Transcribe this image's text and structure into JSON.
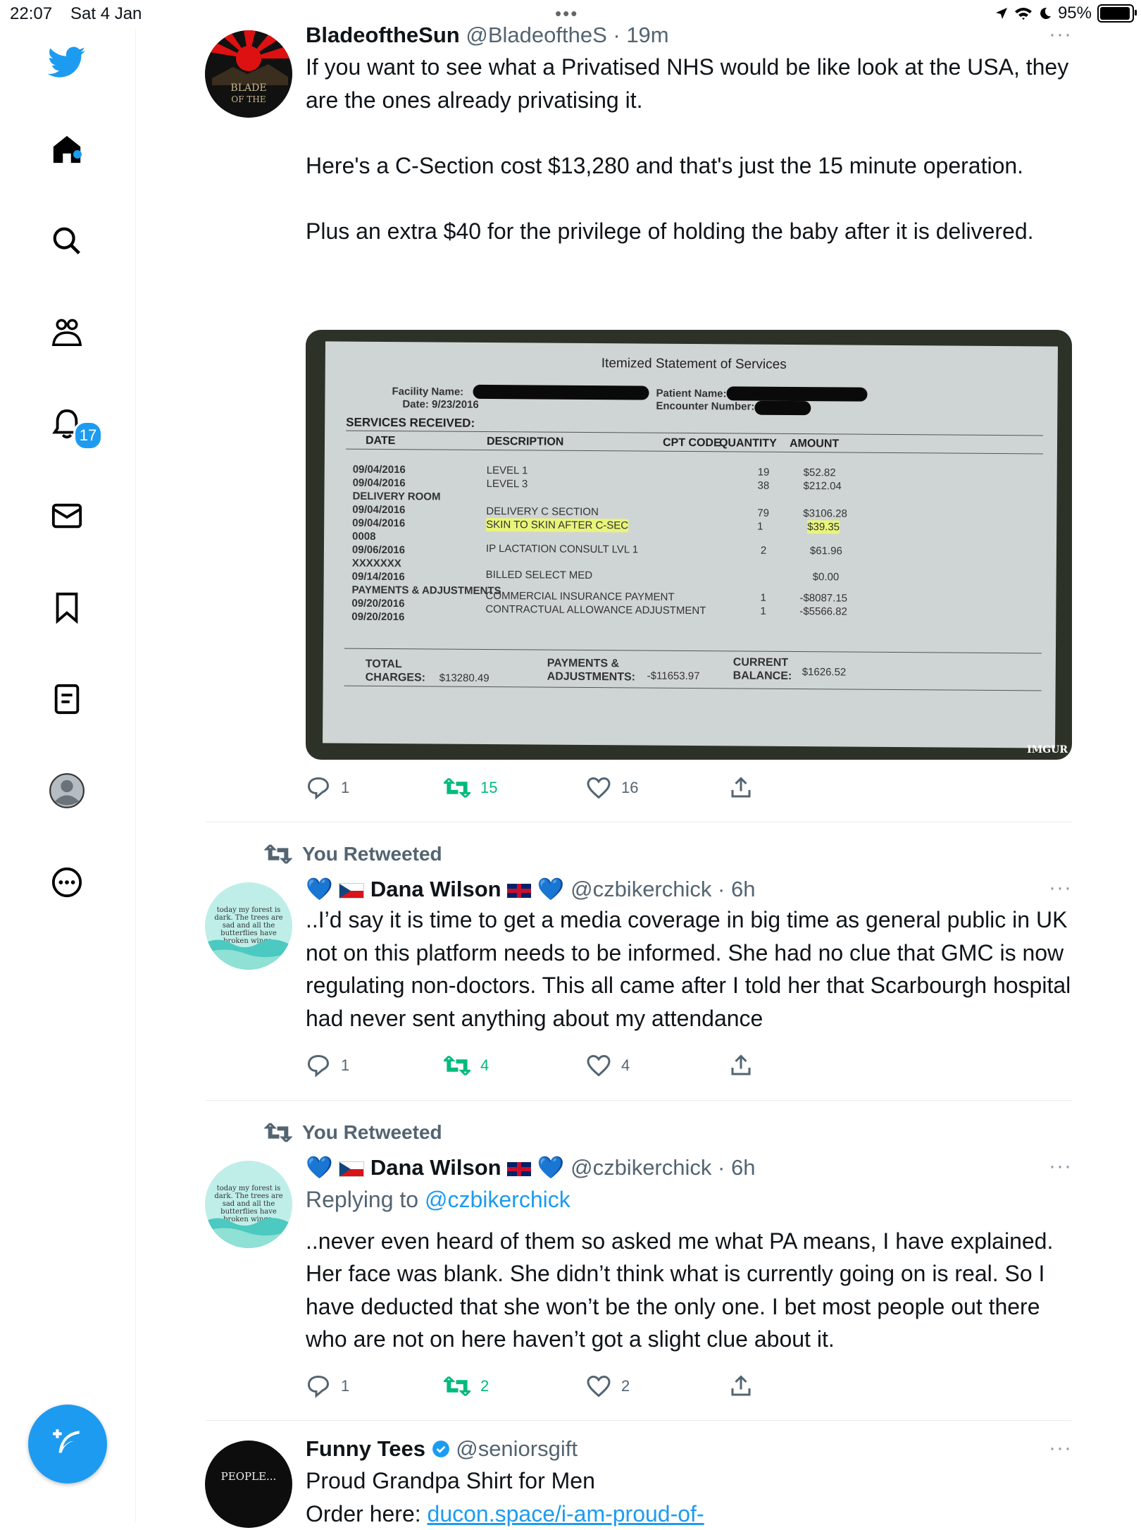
{
  "status": {
    "time": "22:07",
    "date": "Sat 4 Jan",
    "battery": "95%"
  },
  "nav": {
    "notifications_badge": "17"
  },
  "tweets": [
    {
      "name": "BladeoftheSun",
      "handle": "@BladeoftheS",
      "time": "19m",
      "avatar_text": "BLADE OF THE",
      "text": "If you want to see what a Privatised NHS would be like look at the USA, they are the ones already privatising it.\n\nHere's a C-Section cost $13,280 and that's just the 15 minute operation.\n\nPlus an extra $40 for the privilege of holding the baby after it is delivered.",
      "replies": "1",
      "retweets": "15",
      "likes": "16",
      "image": {
        "title": "Itemized Statement of Services",
        "facility_label": "Facility Name:",
        "date_label": "Date: 9/23/2016",
        "patient_label": "Patient Name:",
        "encounter_label": "Encounter Number:",
        "services_label": "SERVICES RECEIVED:",
        "col_date": "DATE",
        "col_desc": "DESCRIPTION",
        "col_cpt": "CPT CODE",
        "col_qty": "QUANTITY",
        "col_amount": "AMOUNT",
        "dates": "09/04/2016\n09/04/2016\nDELIVERY ROOM\n09/04/2016\n09/04/2016\n0008\n09/06/2016\nXXXXXXX\n09/14/2016\nPAYMENTS & ADJUSTMENTS\n09/20/2016\n09/20/2016",
        "desc_1": "LEVEL 1\nLEVEL 3",
        "desc_2": "DELIVERY C SECTION",
        "desc_3": "SKIN TO SKIN AFTER C-SEC",
        "desc_4": "IP LACTATION CONSULT LVL 1",
        "desc_5": "BILLED SELECT MED",
        "desc_6": "COMMERCIAL INSURANCE PAYMENT\nCONTRACTUAL ALLOWANCE ADJUSTMENT",
        "qty_1": "19\n38",
        "qty_2": "79\n1",
        "qty_3": "2",
        "qty_4": "1\n1",
        "amt_1": "$52.82\n$212.04",
        "amt_2": "$3106.28",
        "amt_3": "$39.35",
        "amt_4": "$61.96",
        "amt_5": "$0.00",
        "amt_6": "-$8087.15\n-$5566.82",
        "total_label": "TOTAL\nCHARGES:",
        "total_value": "$13280.49",
        "payments_label": "PAYMENTS &\nADJUSTMENTS:",
        "payments_value": "-$11653.97",
        "balance_label": "CURRENT\nBALANCE:",
        "balance_value": "$1626.52",
        "watermark": "IMGUR"
      }
    },
    {
      "retweeted_label": "You Retweeted",
      "name": "Dana Wilson",
      "handle": "@czbikerchick",
      "time": "6h",
      "avatar_text": "today my forest is dark. The trees are sad and all the butterflies have broken wings.",
      "text": "..I’d say it is time to get a media coverage in big time as general public in UK not on this platform needs to be informed. She had no clue that GMC is now regulating non-doctors. This all came after I told her that Scarbourgh hospital had never sent anything about my attendance",
      "replies": "1",
      "retweets": "4",
      "likes": "4"
    },
    {
      "retweeted_label": "You Retweeted",
      "name": "Dana Wilson",
      "handle": "@czbikerchick",
      "time": "6h",
      "avatar_text": "today my forest is dark. The trees are sad and all the butterflies have broken wings.",
      "replying_prefix": "Replying to ",
      "replying_to": "@czbikerchick",
      "text": "..never even heard of them so asked me what PA means, I have explained. Her face was blank. She didn’t think what is currently going on is real. So I have deducted that she won’t be the only one. I bet most people out there who are not on here haven’t got a slight clue about it.",
      "replies": "1",
      "retweets": "2",
      "likes": "2"
    },
    {
      "name": "Funny Tees",
      "handle": "@seniorsgift",
      "avatar_text": "PEOPLE...",
      "text": "Proud Grandpa Shirt for Men",
      "text2_prefix": "Order here: ",
      "text2_link": "ducon.space/i-am-proud-of-"
    }
  ],
  "colors": {
    "accent": "#1d9bf0",
    "retweet_green": "#00ba7c",
    "muted": "#536471"
  }
}
